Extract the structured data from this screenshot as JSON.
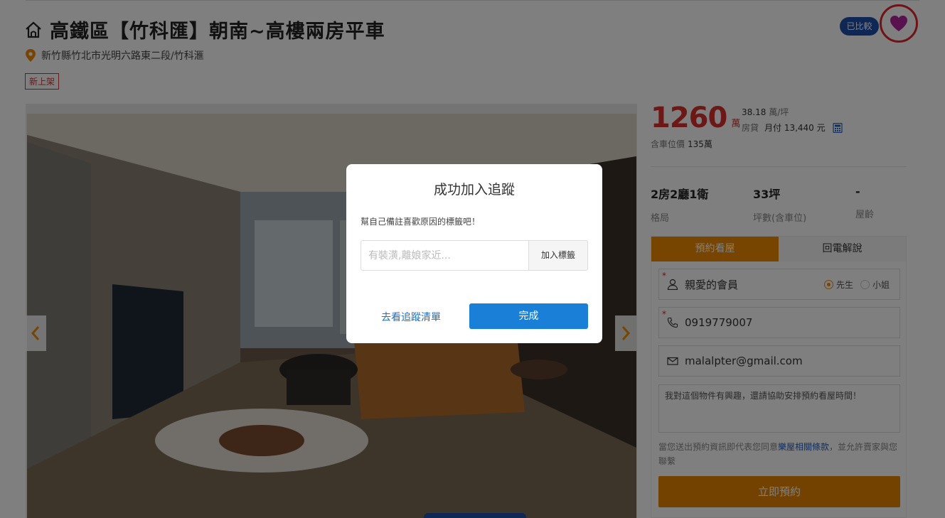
{
  "header": {
    "title": "高鐵區【竹科匯】朝南~高樓兩房平車",
    "address": "新竹縣竹北市光明六路東二段/竹科滙",
    "new_tag": "新上架",
    "compare_badge": "已比較"
  },
  "price": {
    "total": "1260",
    "unit": "萬",
    "unit_price_value": "38.18",
    "unit_price_unit": "萬/坪",
    "loan_label": "房貸",
    "loan_value": "月付 13,440 元",
    "parking_label": "含車位價",
    "parking_value": "135萬"
  },
  "specs": [
    {
      "value": "2房2廳1衛",
      "label": "格局"
    },
    {
      "value": "33坪",
      "label": "坪數(含車位)"
    },
    {
      "value": "-",
      "label": "屋齡"
    }
  ],
  "form": {
    "tab_booking": "預約看屋",
    "tab_callback": "回電解說",
    "name_value": "親愛的會員",
    "radio_mr": "先生",
    "radio_ms": "小姐",
    "phone_value": "0919779007",
    "email_value": "malalpter@gmail.com",
    "message": "我對這個物件有興趣，還請協助安排預約看屋時間！",
    "terms_prefix": "當您送出預約資訊即代表您同意",
    "terms_link": "樂屋相關條款",
    "terms_suffix": "，並允許賣家與您聯繫",
    "submit_label": "立即預約"
  },
  "modal": {
    "title": "成功加入追蹤",
    "description": "幫自己備註喜歡原因的標籤吧！",
    "input_placeholder": "有裝潢,離娘家近...",
    "add_tag_label": "加入標籤",
    "view_list_label": "去看追蹤清單",
    "done_label": "完成"
  },
  "colors": {
    "price_red": "#d9302c",
    "brand_orange": "#ef8a00",
    "brand_blue": "#1a7fd6",
    "heart_purple": "#b0259a"
  },
  "icons": [
    "home-icon",
    "location-pin-icon",
    "heart-icon",
    "calculator-icon",
    "user-icon",
    "phone-icon",
    "mail-icon",
    "chevron-left-icon",
    "chevron-right-icon"
  ]
}
